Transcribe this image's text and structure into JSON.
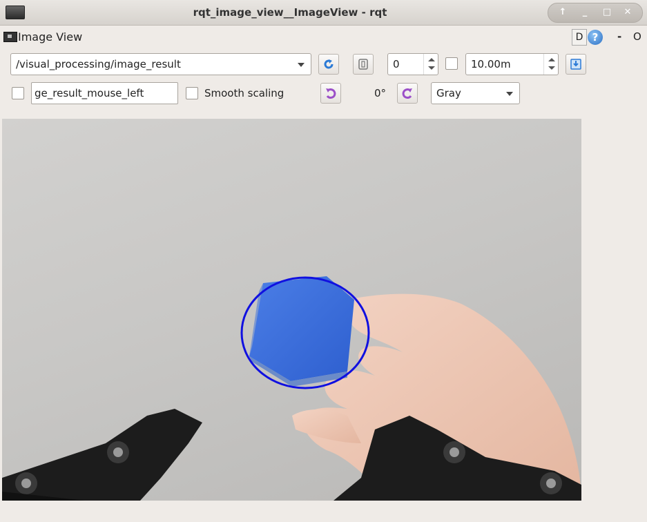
{
  "window": {
    "title": "rqt_image_view__ImageView - rqt",
    "buttons": [
      "up-icon",
      "minimize-icon",
      "maximize-icon",
      "close-icon"
    ]
  },
  "panel": {
    "title": "Image View",
    "d_label": "D",
    "help_label": "?",
    "dash_label": "-",
    "o_label": "O"
  },
  "toolbar": {
    "topic": "/visual_processing/image_result",
    "frame_value": "0",
    "rate_value": "10.00m",
    "mouse_topic": "ge_result_mouse_left",
    "smooth_scaling_label": "Smooth scaling",
    "rotation": "0°",
    "color_scheme": "Gray"
  },
  "colors": {
    "accent_blue": "#2b7ad6",
    "rotate_purple": "#9b4fc8",
    "detection_circle": "#1010e0",
    "cube_blue": "#3a6fe0"
  }
}
